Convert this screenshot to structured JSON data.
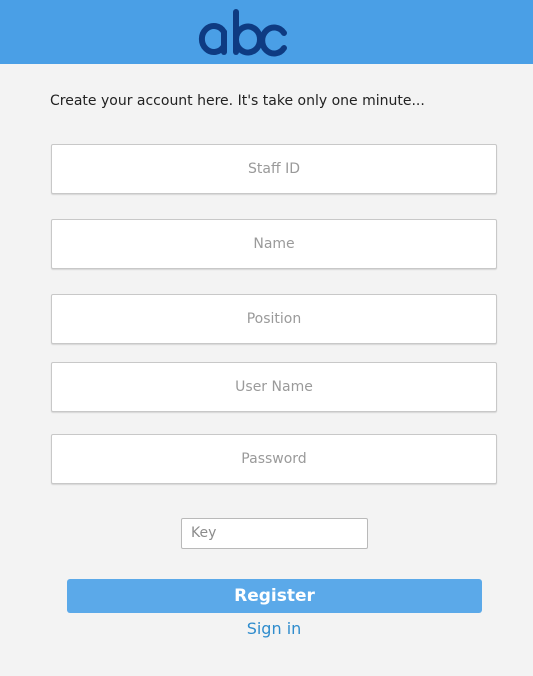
{
  "header": {
    "logo_text": "abc",
    "colors": {
      "bar": "#4a9fe6",
      "logo": "#0e3b82"
    }
  },
  "form": {
    "intro": "Create your account here. It's take only one minute...",
    "fields": [
      {
        "placeholder": "Staff ID"
      },
      {
        "placeholder": "Name"
      },
      {
        "placeholder": "Position"
      },
      {
        "placeholder": "User Name"
      },
      {
        "placeholder": "Password"
      }
    ],
    "key_placeholder": "Key",
    "register_label": "Register",
    "signin_label": "Sign in"
  }
}
